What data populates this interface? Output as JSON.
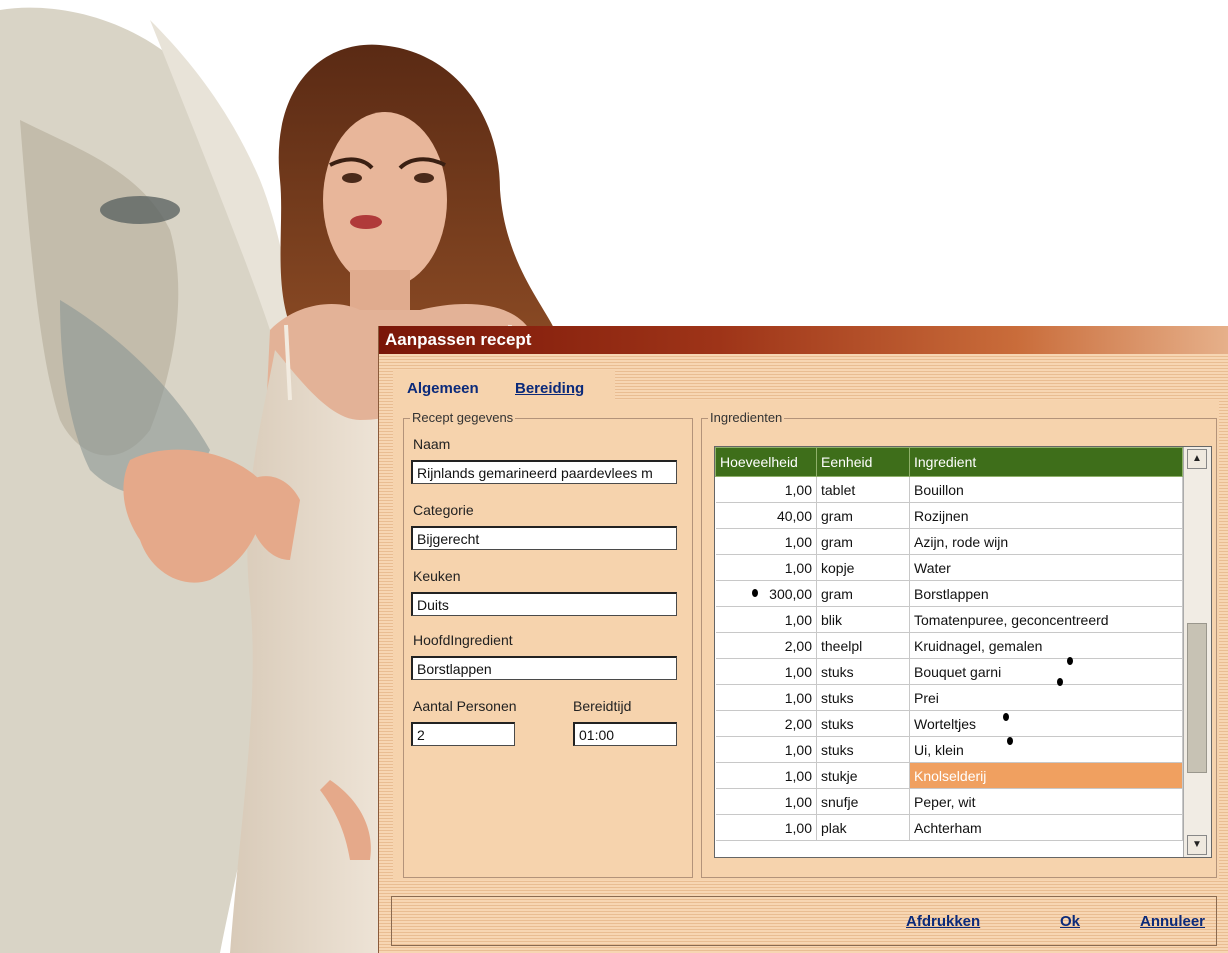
{
  "dialog": {
    "title": "Aanpassen recept",
    "tabs": [
      {
        "label": "Algemeen"
      },
      {
        "label": "Bereiding"
      }
    ]
  },
  "recipe": {
    "group_label": "Recept gegevens",
    "naam": {
      "label": "Naam",
      "value": "Rijnlands gemarineerd paardevlees m"
    },
    "categorie": {
      "label": "Categorie",
      "value": "Bijgerecht"
    },
    "keuken": {
      "label": "Keuken",
      "value": "Duits"
    },
    "hoofdingredient": {
      "label": "HoofdIngredient",
      "value": "Borstlappen"
    },
    "aantal_personen": {
      "label": "Aantal Personen",
      "value": "2"
    },
    "bereidtijd": {
      "label": "Bereidtijd",
      "value": "01:00"
    }
  },
  "ingredients": {
    "group_label": "Ingredienten",
    "columns": [
      "Hoeveelheid",
      "Eenheid",
      "Ingredient"
    ],
    "rows": [
      {
        "qty": "1,00",
        "unit": "tablet",
        "name": "Bouillon"
      },
      {
        "qty": "40,00",
        "unit": "gram",
        "name": "Rozijnen"
      },
      {
        "qty": "1,00",
        "unit": "gram",
        "name": "Azijn, rode wijn"
      },
      {
        "qty": "1,00",
        "unit": "kopje",
        "name": "Water"
      },
      {
        "qty": "300,00",
        "unit": "gram",
        "name": "Borstlappen"
      },
      {
        "qty": "1,00",
        "unit": "blik",
        "name": "Tomatenpuree, geconcentreerd"
      },
      {
        "qty": "2,00",
        "unit": "theelpl",
        "name": "Kruidnagel, gemalen"
      },
      {
        "qty": "1,00",
        "unit": "stuks",
        "name": "Bouquet garni"
      },
      {
        "qty": "1,00",
        "unit": "stuks",
        "name": "Prei"
      },
      {
        "qty": "2,00",
        "unit": "stuks",
        "name": "Worteltjes"
      },
      {
        "qty": "1,00",
        "unit": "stuks",
        "name": "Ui, klein"
      },
      {
        "qty": "1,00",
        "unit": "stukje",
        "name": "Knolselderij",
        "selected": true
      },
      {
        "qty": "1,00",
        "unit": "snufje",
        "name": "Peper, wit"
      },
      {
        "qty": "1,00",
        "unit": "plak",
        "name": "Achterham"
      }
    ]
  },
  "footer": {
    "print_label": "Afdrukken",
    "ok_label": "Ok",
    "cancel_label": "Annuleer"
  },
  "icons": {
    "scroll_up": "scroll-up-icon",
    "scroll_down": "scroll-down-icon"
  }
}
